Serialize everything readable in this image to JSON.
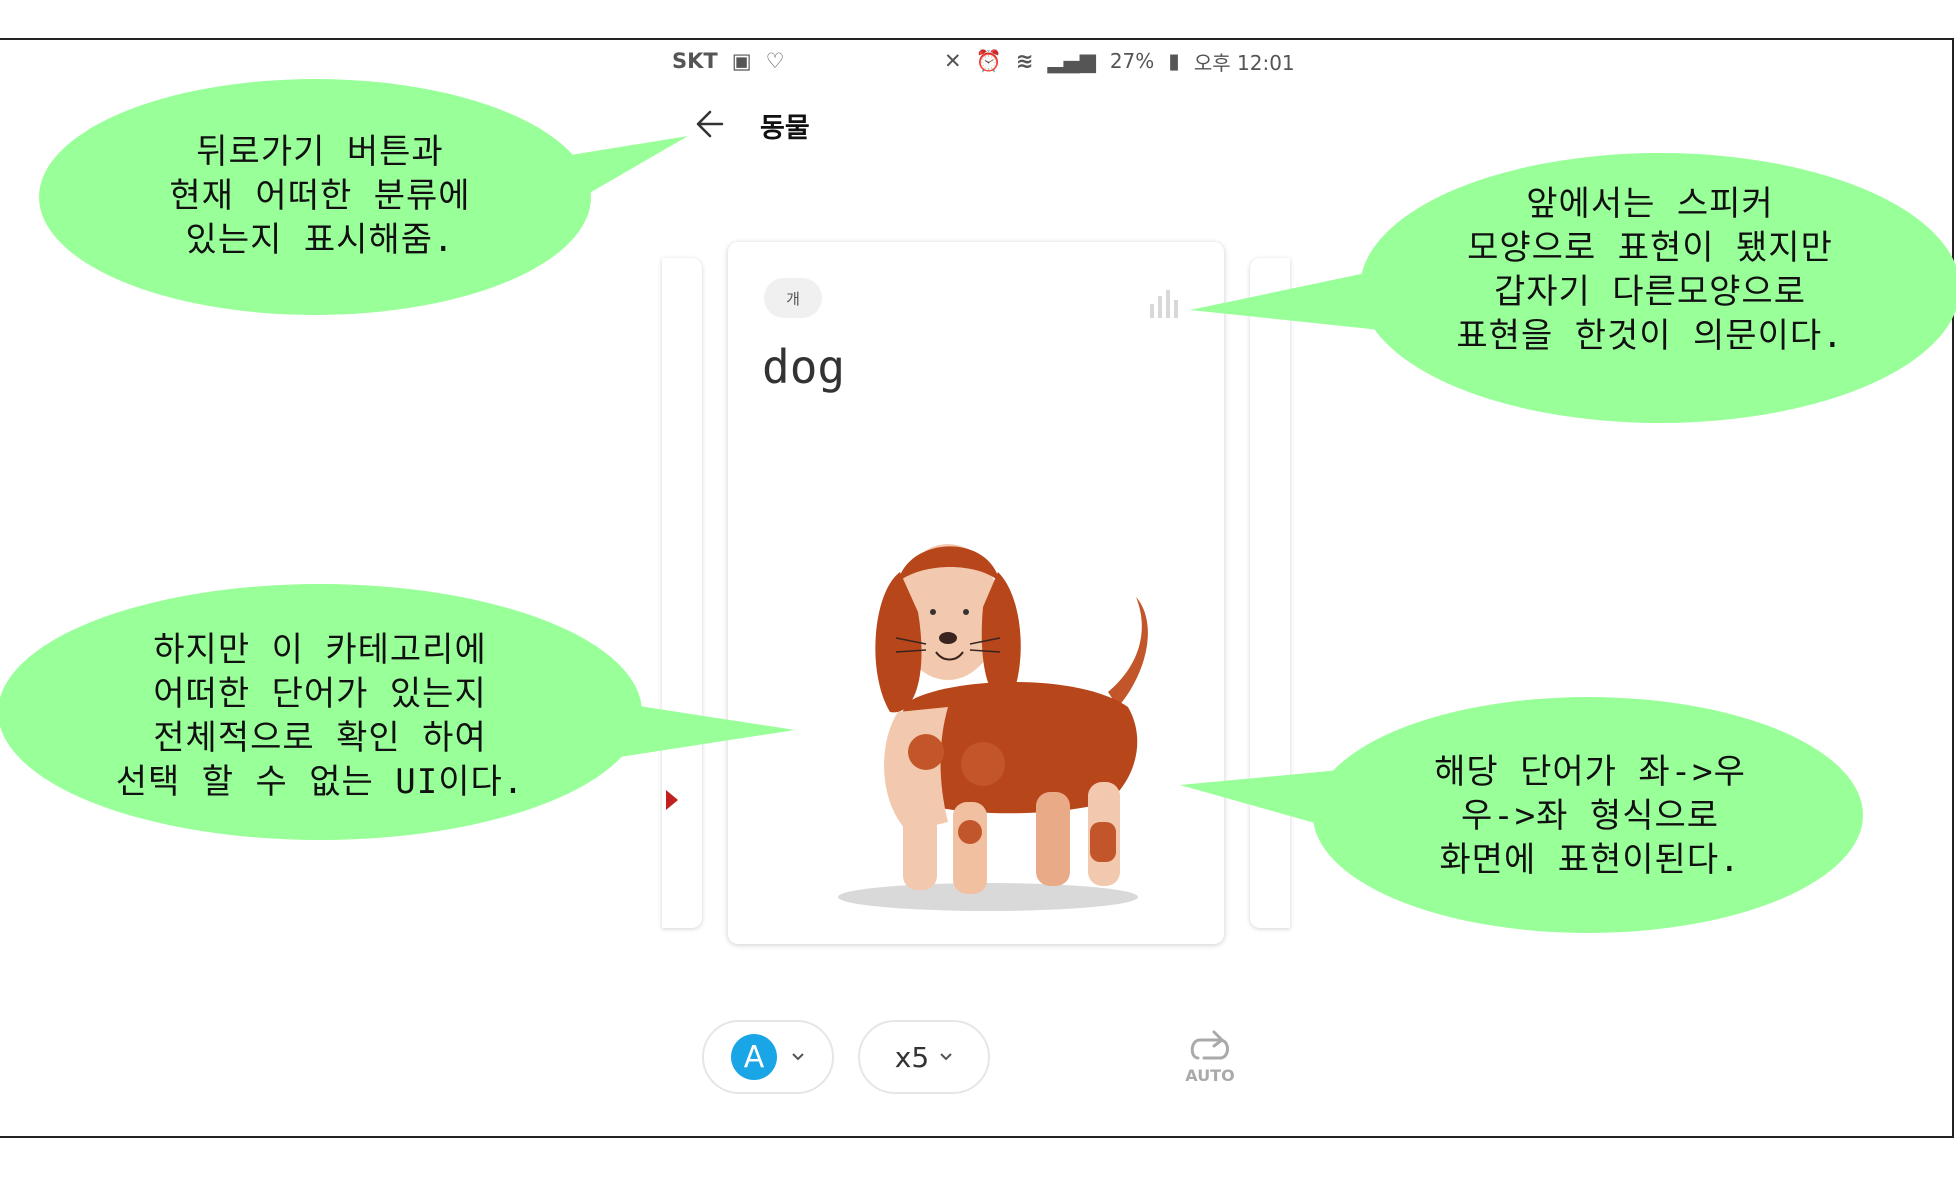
{
  "status_bar": {
    "carrier": "SKT",
    "battery": "27%",
    "time": "오후 12:01"
  },
  "header": {
    "title": "동물"
  },
  "card": {
    "tag": "개",
    "word": "dog",
    "image": "dog-illustration"
  },
  "controls": {
    "voice": "A",
    "repeat": "x5",
    "auto": "AUTO"
  },
  "annotations": [
    "뒤로가기 버튼과\n현재 어떠한 분류에\n있는지 표시해줌.",
    "앞에서는 스피커\n모양으로 표현이 됐지만\n갑자기 다른모양으로\n표현을 한것이 의문이다.",
    "하지만 이 카테고리에\n어떠한 단어가 있는지\n전체적으로 확인 하여\n선택 할 수 없는 UI이다.",
    "해당 단어가 좌->우\n우->좌 형식으로\n화면에 표현이된다."
  ],
  "colors": {
    "bubble": "#99ff99",
    "accent": "#1aa5e6",
    "dog_brown": "#b8461b"
  }
}
